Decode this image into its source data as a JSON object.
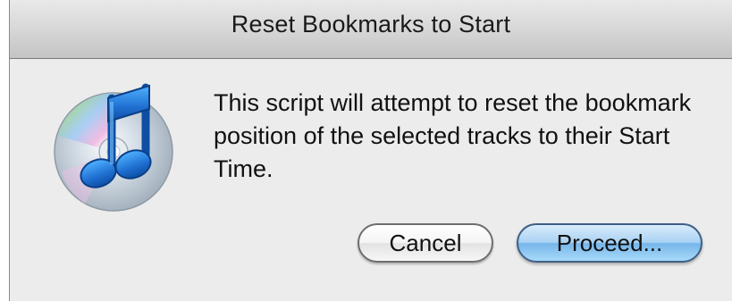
{
  "dialog": {
    "title": "Reset Bookmarks to Start",
    "message": "This script will attempt to reset the bookmark position of the selected tracks to their Start Time.",
    "icon": "itunes-cd-music-note-icon"
  },
  "buttons": {
    "cancel_label": "Cancel",
    "proceed_label": "Proceed..."
  },
  "colors": {
    "dialog_background": "#ececec",
    "default_button_blue": "#76b6ea",
    "icon_note_blue": "#1f6fd1"
  }
}
